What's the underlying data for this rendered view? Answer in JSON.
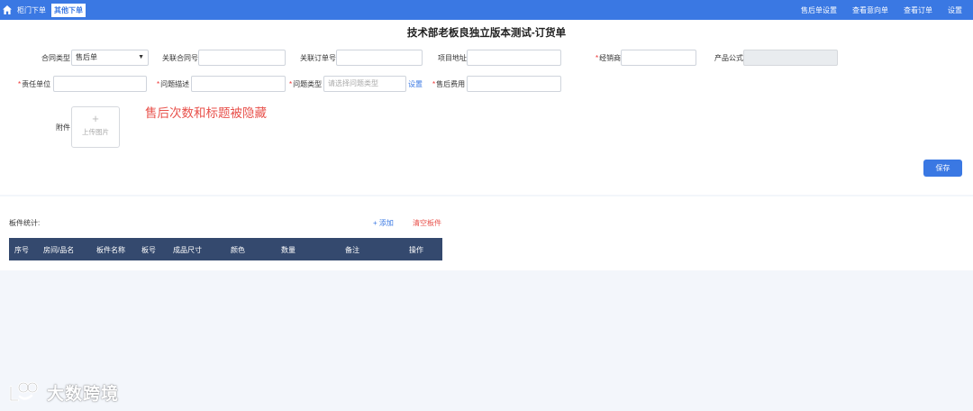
{
  "topbar": {
    "tab_cabinet": "柜门下单",
    "tab_other": "其他下单",
    "right_links": [
      "售后单设置",
      "查看意向单",
      "查看订单",
      "设置"
    ],
    "color": "#3a78e3"
  },
  "form": {
    "title": "技术部老板良独立版本测试-订货单",
    "contract_type_label": "合同类型",
    "contract_type_value": "售后单",
    "related_contract_label": "关联合同号",
    "related_contract_value": "",
    "related_order_label": "关联订单号",
    "related_order_value": "",
    "project_address_label": "项目地址",
    "project_address_value": "",
    "dealer_label": "经销商",
    "dealer_value": "",
    "product_formula_label": "产品公式",
    "product_formula_value": "",
    "responsible_unit_label": "责任单位",
    "responsible_unit_value": "",
    "problem_desc_label": "问题描述",
    "problem_desc_value": "",
    "problem_type_label": "问题类型",
    "problem_type_placeholder": "请选择问题类型",
    "settings_link": "设置",
    "aftersale_fee_label": "售后费用",
    "aftersale_fee_value": "",
    "required_mark": "*",
    "attachment_label": "附件",
    "upload_plus": "+",
    "upload_text": "上传图片",
    "hidden_note": "售后次数和标题被隐藏",
    "save_label": "保存"
  },
  "boards": {
    "stats_label": "板件统计:",
    "add_label": "+ 添加",
    "clear_label": "清空板件",
    "columns": [
      "序号",
      "房间/品名",
      "板件名称",
      "板号",
      "成品尺寸",
      "颜色",
      "数量",
      "备注",
      "操作"
    ],
    "header_color": "#34496e"
  },
  "watermark": {
    "text": "大数跨境"
  }
}
